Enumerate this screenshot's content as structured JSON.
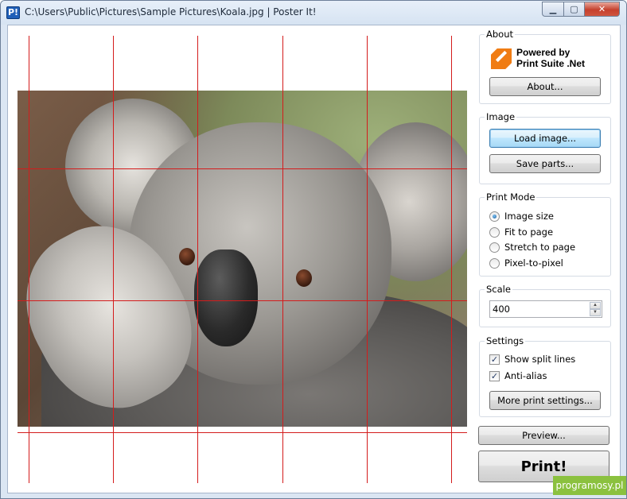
{
  "window": {
    "title": "C:\\Users\\Public\\Pictures\\Sample Pictures\\Koala.jpg | Poster It!",
    "icon_label": "P!",
    "caption": {
      "minimize": "▁",
      "maximize": "▢",
      "close": "✕"
    }
  },
  "preview": {
    "image": "koala-photo",
    "split_color": "#d41c1c"
  },
  "about": {
    "title": "About",
    "logo_line1": "Powered by",
    "logo_line2": "Print Suite .Net",
    "about_button": "About..."
  },
  "image": {
    "title": "Image",
    "load_button": "Load image...",
    "save_button": "Save parts..."
  },
  "print_mode": {
    "title": "Print Mode",
    "options": [
      {
        "label": "Image size",
        "checked": true
      },
      {
        "label": "Fit to page",
        "checked": false
      },
      {
        "label": "Stretch to page",
        "checked": false
      },
      {
        "label": "Pixel-to-pixel",
        "checked": false
      }
    ]
  },
  "scale": {
    "title": "Scale",
    "value": "400"
  },
  "settings": {
    "title": "Settings",
    "show_split_lines": "Show split lines",
    "anti_alias": "Anti-alias",
    "check_mark": "✓",
    "more_button": "More print settings..."
  },
  "actions": {
    "preview_button": "Preview...",
    "print_button": "Print!"
  },
  "watermark": "programosy.pl"
}
